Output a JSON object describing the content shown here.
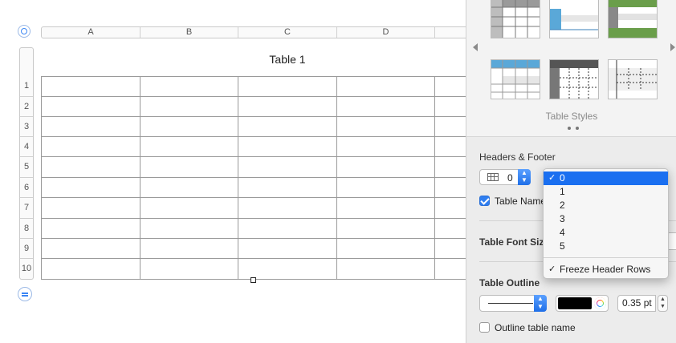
{
  "sheet": {
    "table_title": "Table 1",
    "columns": [
      "A",
      "B",
      "C",
      "D",
      ""
    ],
    "rows": [
      "1",
      "2",
      "3",
      "4",
      "5",
      "6",
      "7",
      "8",
      "9",
      "10"
    ]
  },
  "inspector": {
    "table_styles_label": "Table Styles",
    "headers_footer": {
      "label": "Headers & Footer",
      "header_rows_value": "0"
    },
    "table_name_checkbox": {
      "label": "Table Name",
      "checked": true
    },
    "table_font_size_label": "Table Font Size",
    "table_outline": {
      "label": "Table Outline",
      "color": "#000000",
      "width_value": "0.35 pt"
    },
    "outline_table_name_checkbox": {
      "label": "Outline table name",
      "checked": false
    }
  },
  "header_rows_menu": {
    "options": [
      "0",
      "1",
      "2",
      "3",
      "4",
      "5"
    ],
    "selected": "0",
    "check_glyph": "✓",
    "freeze_label": "Freeze Header Rows",
    "freeze_checked": true
  },
  "colors": {
    "accent": "#1a6ff0",
    "style_blue": "#5aa8d8",
    "style_green": "#6a9e4a",
    "style_dark": "#555555"
  }
}
